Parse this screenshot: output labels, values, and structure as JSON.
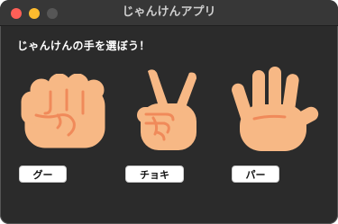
{
  "window": {
    "title": "じゃんけんアプリ"
  },
  "main": {
    "prompt": "じゃんけんの手を選ぼう！",
    "choices": [
      {
        "label": "グー",
        "icon": "rock-hand-icon"
      },
      {
        "label": "チョキ",
        "icon": "scissors-hand-icon"
      },
      {
        "label": "パー",
        "icon": "paper-hand-icon"
      }
    ]
  },
  "colors": {
    "window_bg": "#2b2b2b",
    "titlebar_bg": "#373737",
    "hand_fill": "#f7b885",
    "hand_stroke": "#f08a5a",
    "close": "#fe5f57",
    "minimize": "#febc2e",
    "maximize": "#565656"
  }
}
